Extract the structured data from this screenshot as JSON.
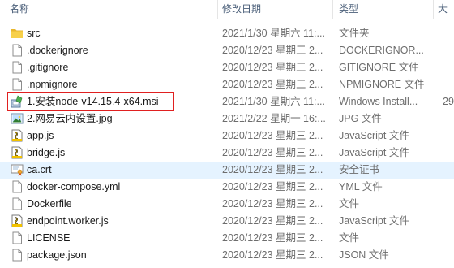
{
  "header": {
    "name": "名称",
    "date": "修改日期",
    "type": "类型",
    "size": "大"
  },
  "files": [
    {
      "name": "src",
      "date": "2021/1/30 星期六 11:...",
      "type": "文件夹",
      "size": "",
      "icon": "folder-icon"
    },
    {
      "name": ".dockerignore",
      "date": "2020/12/23 星期三 2...",
      "type": "DOCKERIGNOR...",
      "size": "",
      "icon": "file-icon"
    },
    {
      "name": ".gitignore",
      "date": "2020/12/23 星期三 2...",
      "type": "GITIGNORE 文件",
      "size": "",
      "icon": "file-icon"
    },
    {
      "name": ".npmignore",
      "date": "2020/12/23 星期三 2...",
      "type": "NPMIGNORE 文件",
      "size": "",
      "icon": "file-icon"
    },
    {
      "name": "1.安装node-v14.15.4-x64.msi",
      "date": "2021/1/30 星期六 11:...",
      "type": "Windows Install...",
      "size": "29",
      "icon": "installer-icon"
    },
    {
      "name": "2.网易云内设置.jpg",
      "date": "2021/2/22 星期一 16:...",
      "type": "JPG 文件",
      "size": "",
      "icon": "image-icon"
    },
    {
      "name": "app.js",
      "date": "2020/12/23 星期三 2...",
      "type": "JavaScript 文件",
      "size": "",
      "icon": "script-icon"
    },
    {
      "name": "bridge.js",
      "date": "2020/12/23 星期三 2...",
      "type": "JavaScript 文件",
      "size": "",
      "icon": "script-icon"
    },
    {
      "name": "ca.crt",
      "date": "2020/12/23 星期三 2...",
      "type": "安全证书",
      "size": "",
      "icon": "certificate-icon"
    },
    {
      "name": "docker-compose.yml",
      "date": "2020/12/23 星期三 2...",
      "type": "YML 文件",
      "size": "",
      "icon": "file-icon"
    },
    {
      "name": "Dockerfile",
      "date": "2020/12/23 星期三 2...",
      "type": "文件",
      "size": "",
      "icon": "file-icon"
    },
    {
      "name": "endpoint.worker.js",
      "date": "2020/12/23 星期三 2...",
      "type": "JavaScript 文件",
      "size": "",
      "icon": "script-icon"
    },
    {
      "name": "LICENSE",
      "date": "2020/12/23 星期三 2...",
      "type": "文件",
      "size": "",
      "icon": "file-icon"
    },
    {
      "name": "package.json",
      "date": "2020/12/23 星期三 2...",
      "type": "JSON 文件",
      "size": "",
      "icon": "file-icon"
    }
  ],
  "selected_index": 8,
  "highlighted_index": 4,
  "colors": {
    "selection": "#e5f3ff",
    "highlight_box": "#e02020",
    "folder": "#f4c542"
  }
}
